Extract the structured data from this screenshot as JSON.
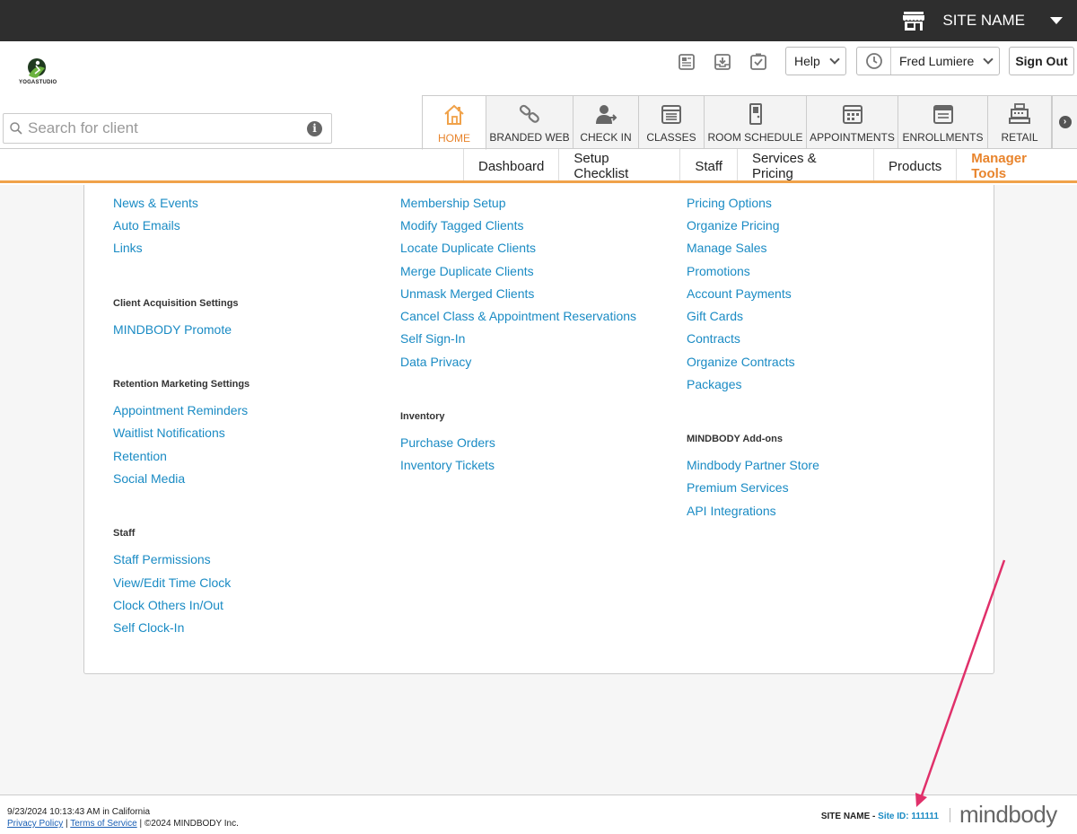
{
  "topbar": {
    "site_name": "SITE NAME"
  },
  "logo": {
    "text": "YOGASTUDIO"
  },
  "header": {
    "help_label": "Help",
    "user_name": "Fred Lumiere",
    "signout_label": "Sign Out"
  },
  "search": {
    "placeholder": "Search for client"
  },
  "tabs": [
    {
      "label": "HOME"
    },
    {
      "label": "BRANDED WEB"
    },
    {
      "label": "CHECK IN"
    },
    {
      "label": "CLASSES"
    },
    {
      "label": "ROOM SCHEDULE"
    },
    {
      "label": "APPOINTMENTS"
    },
    {
      "label": "ENROLLMENTS"
    },
    {
      "label": "RETAIL"
    }
  ],
  "subnav": [
    {
      "label": "Dashboard"
    },
    {
      "label": "Setup Checklist"
    },
    {
      "label": "Staff"
    },
    {
      "label": "Services & Pricing"
    },
    {
      "label": "Products"
    },
    {
      "label": "Manager Tools"
    }
  ],
  "col1": {
    "links_a": [
      "News & Events",
      "Auto Emails",
      "Links"
    ],
    "h_acq": "Client Acquisition Settings",
    "links_b": [
      "MINDBODY Promote"
    ],
    "h_ret": "Retention Marketing Settings",
    "links_c": [
      "Appointment Reminders",
      "Waitlist Notifications",
      "Retention",
      "Social Media"
    ],
    "h_staff": "Staff",
    "links_d": [
      "Staff Permissions",
      "View/Edit Time Clock",
      "Clock Others In/Out",
      "Self Clock-In"
    ]
  },
  "col2": {
    "links_a": [
      "Membership Setup",
      "Modify Tagged Clients",
      "Locate Duplicate Clients",
      "Merge Duplicate Clients",
      "Unmask Merged Clients",
      "Cancel Class & Appointment Reservations",
      "Self Sign-In",
      "Data Privacy"
    ],
    "h_inv": "Inventory",
    "links_b": [
      "Purchase Orders",
      "Inventory Tickets"
    ]
  },
  "col3": {
    "links_a": [
      "Pricing Options",
      "Organize Pricing",
      "Manage Sales",
      "Promotions",
      "Account Payments",
      "Gift Cards",
      "Contracts",
      "Organize Contracts",
      "Packages"
    ],
    "h_addons": "MINDBODY Add-ons",
    "links_b": [
      "Mindbody Partner Store",
      "Premium Services",
      "API Integrations"
    ]
  },
  "footer": {
    "datetime": "9/23/2024 10:13:43 AM in California",
    "privacy": "Privacy Policy",
    "terms": "Terms of Service",
    "copyright": "©2024 MINDBODY Inc.",
    "site_name": "SITE NAME",
    "site_id": "Site ID: 111111",
    "brand": "mindbody"
  },
  "colors": {
    "accent": "#e8842c",
    "link": "#1a8bc4",
    "annotation": "#e0306a"
  }
}
